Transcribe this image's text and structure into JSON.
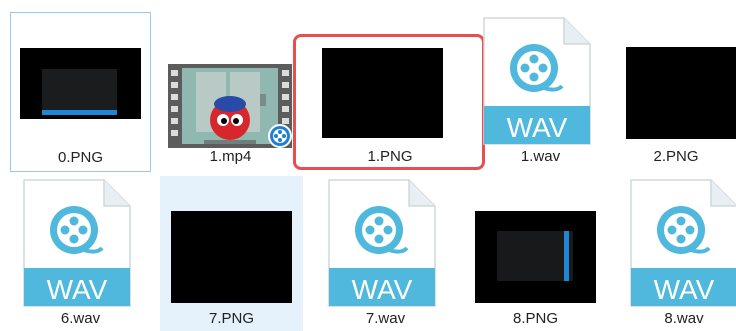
{
  "files": [
    {
      "name": "0.PNG",
      "type": "png-dark-bar"
    },
    {
      "name": "1.mp4",
      "type": "video"
    },
    {
      "name": "1.PNG",
      "type": "png-black"
    },
    {
      "name": "1.wav",
      "type": "wav"
    },
    {
      "name": "2.PNG",
      "type": "png-black"
    },
    {
      "name": "6.wav",
      "type": "wav"
    },
    {
      "name": "7.PNG",
      "type": "png-black"
    },
    {
      "name": "7.wav",
      "type": "wav"
    },
    {
      "name": "8.PNG",
      "type": "png-dark-vbar"
    },
    {
      "name": "8.wav",
      "type": "wav"
    }
  ],
  "wav_badge_text": "WAV",
  "colors": {
    "wav_blue": "#4fb8dc",
    "selection_border": "#99c9f2",
    "hover_fill": "#e5f1fb",
    "annotation_red": "#e84e4e",
    "progress_blue": "#1f86d6"
  },
  "icons": {
    "wav": "music-file-icon",
    "video": "video-file-icon",
    "png": "image-thumbnail-icon"
  }
}
